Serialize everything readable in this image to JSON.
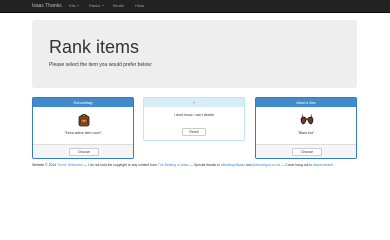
{
  "navbar": {
    "brand": "Isaac Thanks",
    "items": [
      {
        "label": "Kits",
        "has_caret": true
      },
      {
        "label": "Ranks",
        "has_caret": true
      },
      {
        "label": "Binder",
        "has_caret": false
      },
      {
        "label": "Hints",
        "has_caret": false
      }
    ]
  },
  "jumbotron": {
    "title": "Rank items",
    "subtitle": "Please select the item you would prefer below:"
  },
  "panels": [
    {
      "title": "Schoolbag",
      "quote": "\"Extra active item room\"",
      "button": "Choose",
      "icon": "schoolbag-icon"
    },
    {
      "title": "?",
      "quote": "I don't know / can't decide",
      "button": "Reroll"
    },
    {
      "title": "Mom's Bra",
      "quote": "\"Blast bra\"",
      "button": "Choose",
      "icon": "moms-bra-icon"
    }
  ],
  "footer": {
    "part1": "Website © 2014 ",
    "author": "Trevor Selzmann",
    "part2": " — I do not hold the copyright to any content from ",
    "game": "The Binding of Isaac",
    "part3": " — Special thanks to ",
    "thanks1": "#BindingofIsaac",
    "part4": " and ",
    "thanks2": "platinumgod.co.uk",
    "part5": " — Come hang out in ",
    "channel": "#isaacranked"
  },
  "colors": {
    "navbar_bg": "#222222",
    "primary": "#428bca",
    "info_bg": "#d9edf7",
    "jumbotron_bg": "#eeeeee"
  }
}
